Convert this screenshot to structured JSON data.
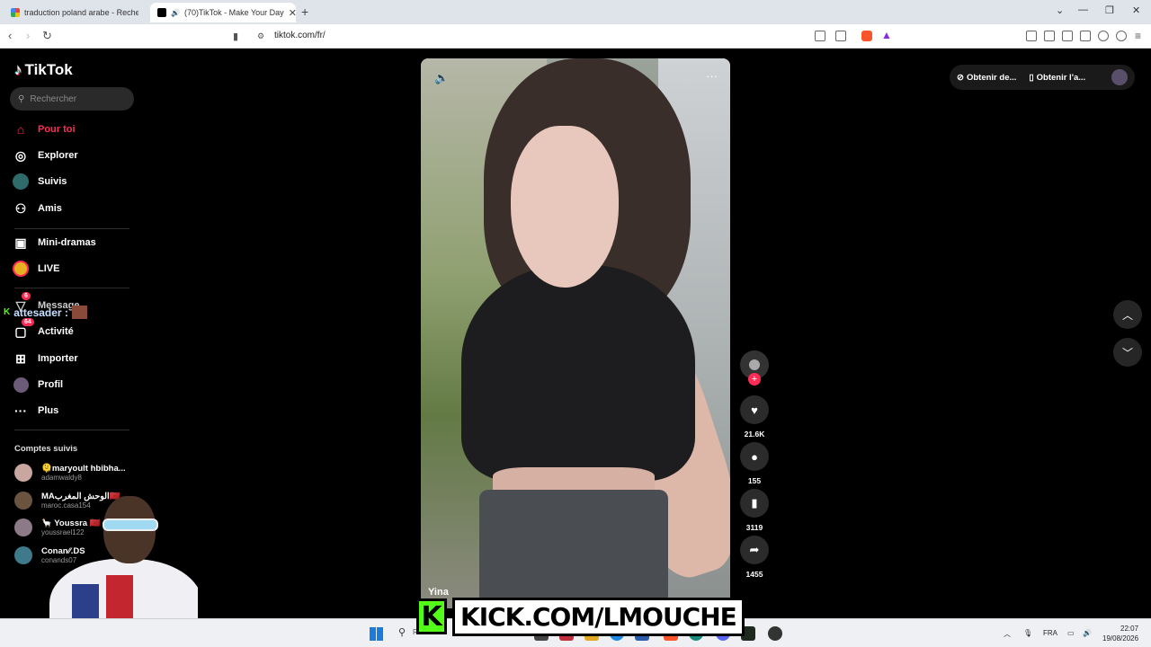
{
  "browser": {
    "tabs": [
      {
        "title": "traduction poland arabe - Recherche"
      },
      {
        "title": "(70)TikTok - Make Your Day"
      }
    ],
    "new_tab_label": "+",
    "url": "tiktok.com/fr/"
  },
  "sidebar": {
    "logo": "TikTok",
    "search_placeholder": "Rechercher",
    "nav": [
      {
        "label": "Pour toi",
        "icon": "home-icon"
      },
      {
        "label": "Explorer",
        "icon": "compass-icon"
      },
      {
        "label": "Suivis",
        "icon": "following-icon"
      },
      {
        "label": "Amis",
        "icon": "friends-icon"
      },
      {
        "label": "Mini-dramas",
        "icon": "film-icon"
      },
      {
        "label": "LIVE",
        "icon": "live-icon"
      },
      {
        "label": "Message",
        "icon": "message-icon",
        "badge": "6"
      },
      {
        "label": "Activité",
        "icon": "activity-icon",
        "badge": "64"
      },
      {
        "label": "Importer",
        "icon": "upload-icon"
      },
      {
        "label": "Profil",
        "icon": "profile-icon"
      },
      {
        "label": "Plus",
        "icon": "more-icon"
      }
    ],
    "followed_title": "Comptes suivis",
    "followed": [
      {
        "name": "🫠maryoult hbibha...",
        "user": "adamwaldy8"
      },
      {
        "name": "MAالوحش المغرب🇲🇦",
        "user": "maroc.casa154"
      },
      {
        "name": "🦙 Youssra 🇲🇦",
        "user": "youssrael122"
      },
      {
        "name": "Conan⁄⁄.DS",
        "user": "conands07"
      }
    ]
  },
  "overlay_username": "attesader :",
  "video": {
    "author": "Yina",
    "likes": "21.6K",
    "comments": "155",
    "saves": "3119",
    "shares": "1455"
  },
  "top_right": {
    "coins_label": "Obtenir de...",
    "app_label": "Obtenir l'a..."
  },
  "stream_banner": {
    "kick_letter": "K",
    "text": "KICK.COM/LMOUCHE"
  },
  "taskbar": {
    "search_label": "R",
    "lang": "FRA",
    "time": "22:07",
    "date": "19/08/2026"
  }
}
